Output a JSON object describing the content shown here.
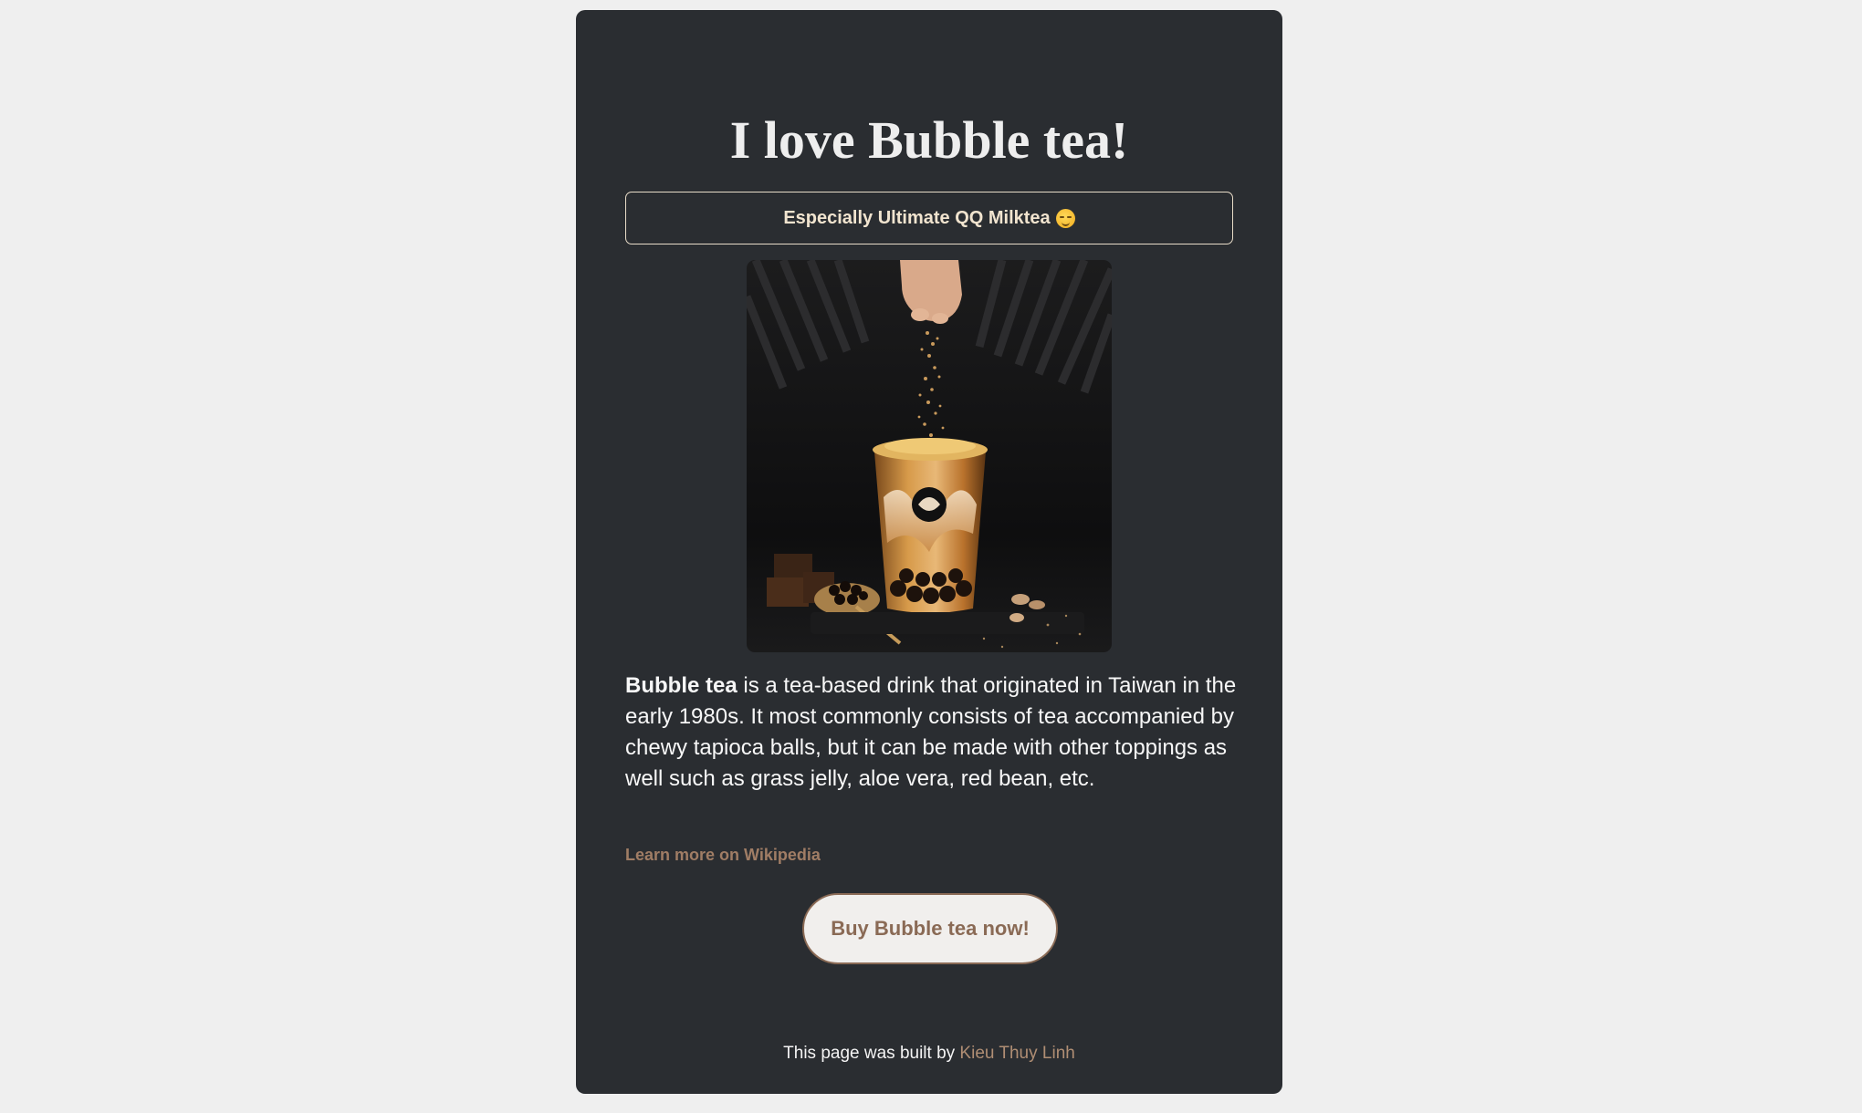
{
  "page": {
    "title": "I love Bubble tea!",
    "tagline": "Especially Ultimate QQ Milktea",
    "tagline_emoji": "relieved-face-emoji"
  },
  "image": {
    "alt": "Bubble tea with brown sugar",
    "icon": "bubble-tea-photo"
  },
  "description": {
    "bold": "Bubble tea",
    "text": " is a tea-based drink that originated in Taiwan in the early 1980s. It most commonly consists of tea accompanied by chewy tapioca balls, but it can be made with other toppings as well such as grass jelly, aloe vera, red bean, etc."
  },
  "links": {
    "wikipedia": "Learn more on Wikipedia"
  },
  "cta": {
    "label": "Buy Bubble tea now!"
  },
  "footer": {
    "prefix": "This page was built by ",
    "author": "Kieu Thuy Linh"
  },
  "colors": {
    "page_background": "#efefef",
    "card_background": "#2a2d31",
    "accent": "#8a6a55",
    "link": "#a07d65",
    "tagline_text": "#f1e4cf"
  }
}
